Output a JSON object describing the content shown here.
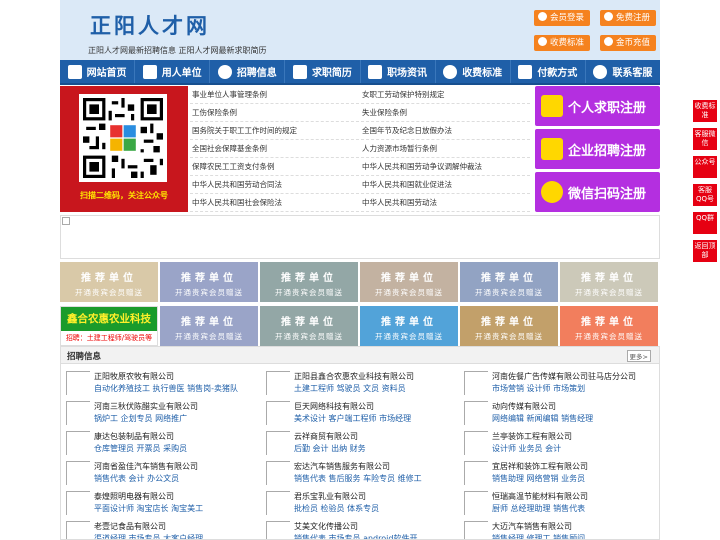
{
  "header": {
    "logo": "正阳人才网",
    "slogan": "正阳人才网最新招聘信息   正阳人才网最新求职简历",
    "buttons": [
      "会员登录",
      "免费注册",
      "收费标准",
      "金币充值"
    ]
  },
  "nav": [
    "网站首页",
    "用人单位",
    "招聘信息",
    "求职简历",
    "职场资讯",
    "收费标准",
    "付款方式",
    "联系客服"
  ],
  "qr_caption": "扫描二维码，关注公众号",
  "news_links": [
    [
      "事业单位人事管理条例",
      "女职工劳动保护特别规定"
    ],
    [
      "工伤保险条例",
      "失业保险条例"
    ],
    [
      "国务院关于职工工作时间的规定",
      "全国年节及纪念日放假办法"
    ],
    [
      "全国社会保障基金条例",
      "人力资源市场暂行条例"
    ],
    [
      "保障农民工工资支付条例",
      "中华人民共和国劳动争议调解仲裁法"
    ],
    [
      "中华人民共和国劳动合同法",
      "中华人民共和国就业促进法"
    ],
    [
      "中华人民共和国社会保险法",
      "中华人民共和国劳动法"
    ]
  ],
  "register": [
    "个人求职注册",
    "企业招聘注册",
    "微信扫码注册"
  ],
  "tiles": {
    "line1": "推荐单位",
    "line2": "开通贵宾会员赠送",
    "special_name": "鑫合农惠农业科技",
    "special_job": "招聘：土建工程师/驾驶员等"
  },
  "colors": {
    "row1": [
      "#d9c9a8",
      "#9aa4c8",
      "#93a7a6",
      "#c3b2a1",
      "#92a3c3",
      "#ccc9b9"
    ],
    "row2": [
      "#9aa4c8",
      "#93a7a6",
      "#52a3d9",
      "#c2a06a",
      "#f27e5d",
      "#ded2b8"
    ]
  },
  "jobs": {
    "title": "招聘信息",
    "more": "更多>",
    "columns": [
      [
        {
          "name": "正阳牧原农牧有限公司",
          "jobs": "自动化养殖技工 执行兽医 销售岗-卖猪队"
        },
        {
          "name": "河南三秋伏陈醋实业有限公司",
          "jobs": "锅炉工 企划专员 网络推广"
        },
        {
          "name": "康达包装制品有限公司",
          "jobs": "仓库管理员 开票员 采购员"
        },
        {
          "name": "河南省盈佳汽车销售有限公司",
          "jobs": "销售代表 会计 办公文员"
        },
        {
          "name": "泰煌照明电器有限公司",
          "jobs": "平面设计师 淘宝店长 淘宝美工"
        },
        {
          "name": "老壹记食品有限公司",
          "jobs": "渠道经理 市场专员 大客户经理"
        }
      ],
      [
        {
          "name": "正阳县鑫合农惠农业科技有限公司",
          "jobs": "土建工程师 驾驶员 文员 资料员"
        },
        {
          "name": "巨天网络科技有限公司",
          "jobs": "美术设计 客户端工程师 市场经理"
        },
        {
          "name": "云祥商贸有限公司",
          "jobs": "后勤 会计 出纳 财务"
        },
        {
          "name": "宏达汽车销售服务有限公司",
          "jobs": "销售代表 售后服务 车险专员 维修工"
        },
        {
          "name": "君乐宝乳业有限公司",
          "jobs": "批检员 检验员 体系专员"
        },
        {
          "name": "艾美文化传播公司",
          "jobs": "销售代表 市场专员 android软件开"
        }
      ],
      [
        {
          "name": "河南佐餐广告传媒有限公司驻马店分公司",
          "jobs": "市场营销 设计师 市场策划"
        },
        {
          "name": "动向传媒有限公司",
          "jobs": "网络编辑 新闻编辑 销售经理"
        },
        {
          "name": "兰亭装饰工程有限公司",
          "jobs": "设计师 业务员 会计"
        },
        {
          "name": "宜居祥和装饰工程有限公司",
          "jobs": "销售助理 网络营销 业务员"
        },
        {
          "name": "恒瑞高温节能材料有限公司",
          "jobs": "厨师 总经理助理 销售代表"
        },
        {
          "name": "大迈汽车销售有限公司",
          "jobs": "销售经理 修理工 销售顾问"
        }
      ]
    ]
  },
  "side_buttons": [
    "收费标准",
    "客服微信",
    "公众号",
    "客服QQ号",
    "QQ群",
    "返回顶部"
  ]
}
